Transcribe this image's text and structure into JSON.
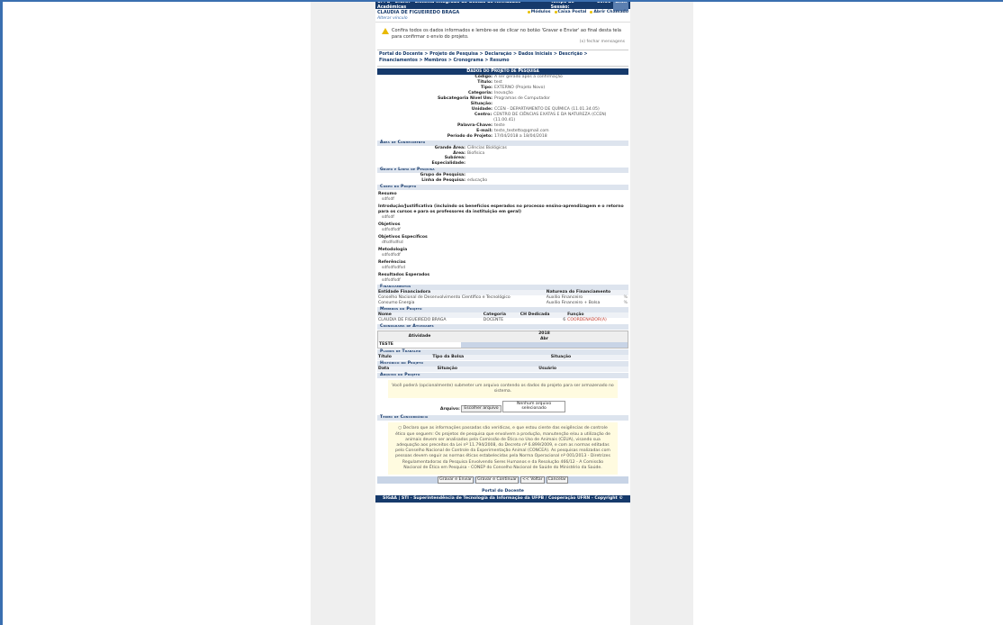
{
  "topbar": {
    "title": "UFPB - SIGAA - Sistema Integrado de Gestão de Atividades Acadêmicas",
    "timer_label": "Tempo de Sessão:",
    "timer": "30:00",
    "exit": "SAIR"
  },
  "user": {
    "name": "CLAUDIA DE FIGUEIREDO BRAGA",
    "change_link": "Alterar vínculo",
    "menu": [
      "Módulos",
      "Caixa Postal",
      "Abrir Chamado"
    ]
  },
  "message": {
    "text": "Confira todos os dados informados e lembre-se de clicar no botão 'Gravar e Enviar' ao final desta tela para confirmar o envio do projeto.",
    "close": "(x) fechar mensagens"
  },
  "breadcrumb": "Portal do Docente > Projeto de Pesquisa > Declaração > Dados Iniciais > Descrição > Financiamentos > Membros > Cronograma > Resumo",
  "main_header": "Dados do Projeto de Pesquisa",
  "project": [
    {
      "k": "Código:",
      "v": "A ser gerado após a confirmação"
    },
    {
      "k": "Título:",
      "v": "test"
    },
    {
      "k": "Tipo:",
      "v": "EXTERNO (Projeto Novo)"
    },
    {
      "k": "Categoria:",
      "v": "Inovação"
    },
    {
      "k": "Subcategoria Nível Um:",
      "v": "Programas de Computador"
    },
    {
      "k": "Situação:",
      "v": ""
    },
    {
      "k": "Unidade:",
      "v": "CCEN - DEPARTAMENTO DE QUÍMICA (11.01.34.05)"
    },
    {
      "k": "Centro:",
      "v": "CENTRO DE CIÊNCIAS EXATAS E DA NATUREZA (CCEN) (11.00.41)"
    },
    {
      "k": "Palavra-Chave:",
      "v": "teste"
    },
    {
      "k": "E-mail:",
      "v": "teste_testetto@gmail.com"
    },
    {
      "k": "Período do Projeto:",
      "v": "17/04/2018 a 18/04/2018"
    }
  ],
  "area": {
    "title": "Área de Conhecimento",
    "rows": [
      {
        "k": "Grande Área:",
        "v": "Ciências Biológicas"
      },
      {
        "k": "Área:",
        "v": "Biofísica"
      },
      {
        "k": "Subárea:",
        "v": ""
      },
      {
        "k": "Especialidade:",
        "v": ""
      }
    ]
  },
  "grupo": {
    "title": "Grupo e Linha de Pesquisa",
    "rows": [
      {
        "k": "Grupo de Pesquisa:",
        "v": ""
      },
      {
        "k": "Linha de Pesquisa:",
        "v": "educação"
      }
    ]
  },
  "corpo": {
    "title": "Corpo do Projeto",
    "blocks": [
      {
        "t": "Resumo",
        "d": "sdfsdf"
      },
      {
        "t": "Introdução/Justificativa (incluindo os benefícios esperados no processo ensino-aprendizagem e o retorno para os cursos e para os professores da instituição em geral)",
        "d": "sdfsdf"
      },
      {
        "t": "Objetivos",
        "d": "sdfsdfsdf"
      },
      {
        "t": "Objetivos Específicos",
        "d": "dfsdfsdfsd"
      },
      {
        "t": "Metodologia",
        "d": "sdfsdfsdf"
      },
      {
        "t": "Referências",
        "d": "sdfsdfsdfsd"
      },
      {
        "t": "Resultados Esperados",
        "d": "sdfsdfsdf"
      }
    ]
  },
  "financ": {
    "title": "Financiamentos",
    "headers": [
      "Entidade Financiadora",
      "Natureza do Financiamento"
    ],
    "rows": [
      [
        "Conselho Nacional de Desenvolvimento Científico e Tecnológico",
        "Auxílio Financeiro",
        "%"
      ],
      [
        "Consumo Energia",
        "Auxílio Financeiro + Bolsa",
        "%"
      ]
    ]
  },
  "membros": {
    "title": "Membros do Projeto",
    "headers": [
      "Nome",
      "Categoria",
      "CH Dedicada",
      "Função"
    ],
    "rows": [
      [
        "CLAUDIA DE FIGUEIREDO BRAGA",
        "DOCENTE",
        "6",
        "COORDENADOR(A)"
      ]
    ]
  },
  "cronograma": {
    "title": "Cronograma de Atividades",
    "col_head": "Atividade",
    "year": "2018",
    "month": "Abr",
    "activity": "TESTE"
  },
  "planos": {
    "title": "Planos de Trabalho",
    "headers": [
      "Título",
      "Tipo da Bolsa",
      "Situação"
    ]
  },
  "historico": {
    "title": "Histórico do Projeto",
    "headers": [
      "Data",
      "Situação",
      "Usuário"
    ]
  },
  "arquivo": {
    "title": "Arquivo do Projeto",
    "info": "Você poderá (opcionalmente) submeter um arquivo contendo os dados do projeto para ser armazenado no sistema.",
    "label": "Arquivo:",
    "choose": "Escolher arquivo",
    "none": "Nenhum arquivo selecionado"
  },
  "termo": {
    "title": "Termo de Concordância",
    "text": "Declaro que as informações passadas são verídicas, e que estou ciente das exigências de controle ético que seguem: Os projetos de pesquisa que envolvem a produção, manutenção e/ou a utilização de animais devem ser analisados pela Comissão de Ética no Uso de Animais (CEUA), visando sua adequação aos preceitos da Lei nº 11.794/2008, do Decreto nº 6.899/2009, e com as normas editadas pelo Conselho Nacional de Controle da Experimentação Animal (CONCEA). As pesquisas realizadas com pessoas devem seguir as normas éticas estabelecidas pela Norma Operacional nº 001/2013 - Diretrizes Regulamentadoras da Pesquisa Envolvendo Seres Humanos e da Resolução 466/12 - A Comissão Nacional de Ética em Pesquisa - CONEP do Conselho Nacional de Saúde do Ministério da Saúde."
  },
  "buttons": [
    "Gravar e Enviar",
    "Gravar e Continuar",
    "<< Voltar",
    "Cancelar"
  ],
  "portal_link": "Portal do Docente",
  "footer": "SIGAA | STI - Superintendência de Tecnologia da Informação da UFPB / Cooperação UFRN - Copyright ©",
  "colors": {
    "primary": "#163a6b",
    "section": "#dde4ee",
    "notice": "#fffbe0",
    "frame": "#3a6fb0"
  }
}
